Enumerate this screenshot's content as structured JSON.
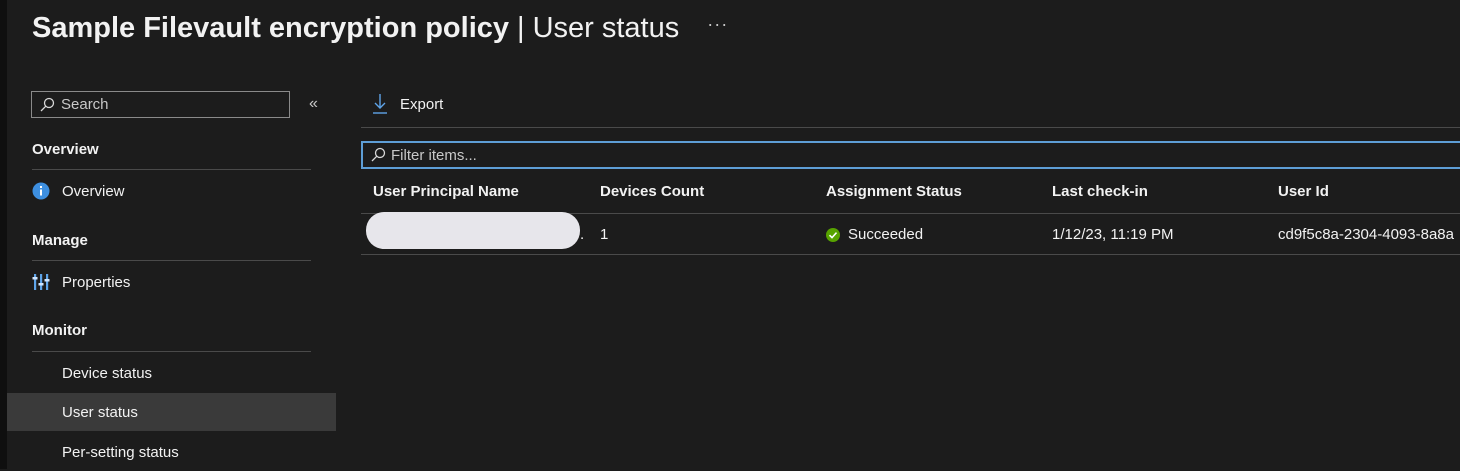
{
  "header": {
    "title": "Sample Filevault encryption policy",
    "separator": "|",
    "subtitle": "User status",
    "more_label": "···"
  },
  "sidebar": {
    "search_placeholder": "Search",
    "collapse_label": "«",
    "sections": [
      {
        "heading": "Overview",
        "items": [
          {
            "label": "Overview",
            "icon": "info-icon"
          }
        ]
      },
      {
        "heading": "Manage",
        "items": [
          {
            "label": "Properties",
            "icon": "sliders-icon"
          }
        ]
      },
      {
        "heading": "Monitor",
        "items": [
          {
            "label": "Device status"
          },
          {
            "label": "User status",
            "active": true
          },
          {
            "label": "Per-setting status"
          }
        ]
      }
    ]
  },
  "toolbar": {
    "export_label": "Export"
  },
  "filter": {
    "placeholder": "Filter items..."
  },
  "table": {
    "columns": [
      "User Principal Name",
      "Devices Count",
      "Assignment Status",
      "Last check-in",
      "User Id"
    ],
    "rows": [
      {
        "user_principal_name_suffix": ".",
        "devices_count": "1",
        "assignment_status": "Succeeded",
        "last_check_in": "1/12/23, 11:19 PM",
        "user_id": "cd9f5c8a-2304-4093-8a8a"
      }
    ]
  },
  "colors": {
    "background": "#1c1c1c",
    "accent": "#5e9ed6",
    "success": "#57a300",
    "active_nav": "#3a3a3a"
  }
}
